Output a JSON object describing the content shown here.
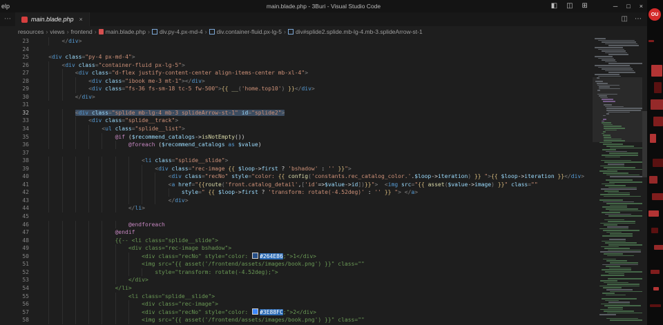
{
  "titlebar": {
    "menu_fragment": "elp",
    "title": "main.blade.php - 3Buri - Visual Studio Code"
  },
  "icons": {
    "toggle_sidebar": "◧",
    "toggle_panel": "◫",
    "customize_layout": "⊞",
    "minimize": "─",
    "maximize": "□",
    "close": "×",
    "overflow": "⋯",
    "split_editor": "◫",
    "more_actions": "⋯",
    "tab_close": "×",
    "breadcrumb_separator": "›"
  },
  "tabbar": {
    "tab": {
      "label": "main.blade.php"
    }
  },
  "breadcrumbs": [
    {
      "label": "resources",
      "icon": "none"
    },
    {
      "label": "views",
      "icon": "none"
    },
    {
      "label": "frontend",
      "icon": "none"
    },
    {
      "label": "main.blade.php",
      "icon": "file"
    },
    {
      "label": "div.py-4.px-md-4",
      "icon": "symbol"
    },
    {
      "label": "div.container-fluid.px-lg-5",
      "icon": "symbol"
    },
    {
      "label": "div#splide2.splide.mb-lg-4.mb-3.splideArrow-st-1",
      "icon": "symbol"
    }
  ],
  "colors": {
    "selection": "#3c4c60",
    "hex_highlight": "#2d6cb5",
    "file_icon": "#d63f3f",
    "comment": "#6a9955",
    "swatch_1": "#264E86",
    "swatch_2": "#3E88FC"
  },
  "background_app": {
    "badge_text": "OU"
  },
  "editor": {
    "lines": [
      {
        "n": 23,
        "ind": 8,
        "t": [
          [
            "p",
            "</"
          ],
          [
            "t",
            "div"
          ],
          [
            "p",
            ">"
          ]
        ]
      },
      {
        "n": 24,
        "ind": 0,
        "t": []
      },
      {
        "n": 25,
        "ind": 4,
        "t": [
          [
            "p",
            "<"
          ],
          [
            "t",
            "div"
          ],
          [
            "x",
            " "
          ],
          [
            "a",
            "class"
          ],
          [
            "p",
            "="
          ],
          [
            "s",
            "\"py-4 px-md-4\""
          ],
          [
            "p",
            ">"
          ]
        ]
      },
      {
        "n": 26,
        "ind": 8,
        "t": [
          [
            "p",
            "<"
          ],
          [
            "t",
            "div"
          ],
          [
            "x",
            " "
          ],
          [
            "a",
            "class"
          ],
          [
            "p",
            "="
          ],
          [
            "s",
            "\"container-fluid px-lg-5\""
          ],
          [
            "p",
            ">"
          ]
        ]
      },
      {
        "n": 27,
        "ind": 12,
        "t": [
          [
            "p",
            "<"
          ],
          [
            "t",
            "div"
          ],
          [
            "x",
            " "
          ],
          [
            "a",
            "class"
          ],
          [
            "p",
            "="
          ],
          [
            "s",
            "\"d-flex justify-content-center align-items-center mb-xl-4\""
          ],
          [
            "p",
            ">"
          ]
        ]
      },
      {
        "n": 28,
        "ind": 16,
        "t": [
          [
            "p",
            "<"
          ],
          [
            "t",
            "div"
          ],
          [
            "x",
            " "
          ],
          [
            "a",
            "class"
          ],
          [
            "p",
            "="
          ],
          [
            "s",
            "\"ibook me-3 mt-1\""
          ],
          [
            "p",
            ">"
          ],
          [
            "p",
            "</"
          ],
          [
            "t",
            "div"
          ],
          [
            "p",
            ">"
          ]
        ]
      },
      {
        "n": 29,
        "ind": 16,
        "t": [
          [
            "p",
            "<"
          ],
          [
            "t",
            "div"
          ],
          [
            "x",
            " "
          ],
          [
            "a",
            "class"
          ],
          [
            "p",
            "="
          ],
          [
            "s",
            "\"fs-36 fs-sm-18 tc-5 fw-500\""
          ],
          [
            "p",
            ">"
          ],
          [
            "br",
            "{{"
          ],
          [
            "x",
            " "
          ],
          [
            "f",
            "__"
          ],
          [
            "p",
            "("
          ],
          [
            "s",
            "'home.top10'"
          ],
          [
            "p",
            ")"
          ],
          [
            "x",
            " "
          ],
          [
            "br",
            "}}"
          ],
          [
            "p",
            "</"
          ],
          [
            "t",
            "div"
          ],
          [
            "p",
            ">"
          ]
        ]
      },
      {
        "n": 30,
        "ind": 12,
        "t": [
          [
            "p",
            "</"
          ],
          [
            "t",
            "div"
          ],
          [
            "p",
            ">"
          ]
        ]
      },
      {
        "n": 31,
        "ind": 0,
        "t": []
      },
      {
        "n": 32,
        "ind": 12,
        "sel": true,
        "t": [
          [
            "p",
            "<"
          ],
          [
            "t",
            "div"
          ],
          [
            "x",
            " "
          ],
          [
            "a",
            "class"
          ],
          [
            "p",
            "="
          ],
          [
            "s",
            "\"splide mb-lg-4 mb-3 splideArrow-st-1\""
          ],
          [
            "x",
            " "
          ],
          [
            "a",
            "id"
          ],
          [
            "p",
            "="
          ],
          [
            "s",
            "\"splide2\""
          ],
          [
            "p",
            ">"
          ]
        ]
      },
      {
        "n": 33,
        "ind": 16,
        "t": [
          [
            "p",
            "<"
          ],
          [
            "t",
            "div"
          ],
          [
            "x",
            " "
          ],
          [
            "a",
            "class"
          ],
          [
            "p",
            "="
          ],
          [
            "s",
            "\"splide__track\""
          ],
          [
            "p",
            ">"
          ]
        ]
      },
      {
        "n": 34,
        "ind": 20,
        "t": [
          [
            "p",
            "<"
          ],
          [
            "t",
            "ul"
          ],
          [
            "x",
            " "
          ],
          [
            "a",
            "class"
          ],
          [
            "p",
            "="
          ],
          [
            "s",
            "\"splide__list\""
          ],
          [
            "p",
            ">"
          ]
        ]
      },
      {
        "n": 35,
        "ind": 24,
        "t": [
          [
            "b",
            "@if"
          ],
          [
            "x",
            " ("
          ],
          [
            "v",
            "$recommend_catalogs"
          ],
          [
            "x",
            "->"
          ],
          [
            "f",
            "isNotEmpty"
          ],
          [
            "x",
            "())"
          ]
        ]
      },
      {
        "n": 36,
        "ind": 28,
        "t": [
          [
            "b",
            "@foreach"
          ],
          [
            "x",
            " ("
          ],
          [
            "v",
            "$recommend_catalogs"
          ],
          [
            "k",
            " as "
          ],
          [
            "v",
            "$value"
          ],
          [
            "x",
            ")"
          ]
        ]
      },
      {
        "n": 37,
        "ind": 0,
        "t": []
      },
      {
        "n": 38,
        "ind": 32,
        "t": [
          [
            "p",
            "<"
          ],
          [
            "t",
            "li"
          ],
          [
            "x",
            " "
          ],
          [
            "a",
            "class"
          ],
          [
            "p",
            "="
          ],
          [
            "s",
            "\"splide__slide\""
          ],
          [
            "p",
            ">"
          ]
        ]
      },
      {
        "n": 39,
        "ind": 36,
        "t": [
          [
            "p",
            "<"
          ],
          [
            "t",
            "div"
          ],
          [
            "x",
            " "
          ],
          [
            "a",
            "class"
          ],
          [
            "p",
            "="
          ],
          [
            "s",
            "\"rec-image "
          ],
          [
            "br",
            "{{"
          ],
          [
            "x",
            " "
          ],
          [
            "v",
            "$loop"
          ],
          [
            "x",
            "->"
          ],
          [
            "a",
            "first"
          ],
          [
            "x",
            " ? "
          ],
          [
            "s",
            "'bshadow'"
          ],
          [
            "x",
            " : "
          ],
          [
            "s",
            "''"
          ],
          [
            "x",
            " "
          ],
          [
            "br",
            "}}"
          ],
          [
            "s",
            "\""
          ],
          [
            "p",
            ">"
          ]
        ]
      },
      {
        "n": 40,
        "ind": 40,
        "t": [
          [
            "p",
            "<"
          ],
          [
            "t",
            "div"
          ],
          [
            "x",
            " "
          ],
          [
            "a",
            "class"
          ],
          [
            "p",
            "="
          ],
          [
            "s",
            "\"recNo\""
          ],
          [
            "x",
            " "
          ],
          [
            "a",
            "style"
          ],
          [
            "p",
            "="
          ],
          [
            "s",
            "\"color: "
          ],
          [
            "br",
            "{{"
          ],
          [
            "x",
            " "
          ],
          [
            "f",
            "config"
          ],
          [
            "p",
            "("
          ],
          [
            "s",
            "'constants.rec_catalog_color.'"
          ],
          [
            "x",
            "."
          ],
          [
            "v",
            "$loop"
          ],
          [
            "x",
            "->"
          ],
          [
            "a",
            "iteration"
          ],
          [
            "p",
            ")"
          ],
          [
            "x",
            " "
          ],
          [
            "br",
            "}}"
          ],
          [
            "s",
            " \""
          ],
          [
            "p",
            ">"
          ],
          [
            "br",
            "{{"
          ],
          [
            "x",
            " "
          ],
          [
            "v",
            "$loop"
          ],
          [
            "x",
            "->"
          ],
          [
            "a",
            "iteration"
          ],
          [
            "x",
            " "
          ],
          [
            "br",
            "}}"
          ],
          [
            "p",
            "</"
          ],
          [
            "t",
            "div"
          ],
          [
            "p",
            ">"
          ]
        ]
      },
      {
        "n": 41,
        "ind": 40,
        "t": [
          [
            "p",
            "<"
          ],
          [
            "t",
            "a"
          ],
          [
            "x",
            " "
          ],
          [
            "a",
            "href"
          ],
          [
            "p",
            "="
          ],
          [
            "s",
            "\""
          ],
          [
            "br",
            "{{"
          ],
          [
            "f",
            "route"
          ],
          [
            "p",
            "("
          ],
          [
            "s",
            "'front.catalog_detail'"
          ],
          [
            "x",
            ","
          ],
          [
            "p",
            "["
          ],
          [
            "s",
            "'id'"
          ],
          [
            "x",
            "=>"
          ],
          [
            "v",
            "$value"
          ],
          [
            "x",
            "->"
          ],
          [
            "a",
            "id"
          ],
          [
            "p",
            "])"
          ],
          [
            "br",
            "}}"
          ],
          [
            "s",
            "\""
          ],
          [
            "p",
            ">"
          ],
          [
            "x",
            "  "
          ],
          [
            "p",
            "<"
          ],
          [
            "t",
            "img"
          ],
          [
            "x",
            " "
          ],
          [
            "a",
            "src"
          ],
          [
            "p",
            "="
          ],
          [
            "s",
            "\""
          ],
          [
            "br",
            "{{"
          ],
          [
            "x",
            " "
          ],
          [
            "f",
            "asset"
          ],
          [
            "p",
            "("
          ],
          [
            "v",
            "$value"
          ],
          [
            "x",
            "->"
          ],
          [
            "a",
            "image"
          ],
          [
            "p",
            ")"
          ],
          [
            "x",
            " "
          ],
          [
            "br",
            "}}"
          ],
          [
            "s",
            "\""
          ],
          [
            "x",
            " "
          ],
          [
            "a",
            "class"
          ],
          [
            "p",
            "="
          ],
          [
            "s",
            "\"\""
          ]
        ]
      },
      {
        "n": 42,
        "ind": 44,
        "t": [
          [
            "a",
            "style"
          ],
          [
            "p",
            "="
          ],
          [
            "s",
            "\" "
          ],
          [
            "br",
            "{{"
          ],
          [
            "x",
            " "
          ],
          [
            "v",
            "$loop"
          ],
          [
            "x",
            "->"
          ],
          [
            "a",
            "first"
          ],
          [
            "x",
            " ? "
          ],
          [
            "s",
            "'transform: rotate(-4.52deg)'"
          ],
          [
            "x",
            " : "
          ],
          [
            "s",
            "''"
          ],
          [
            "x",
            " "
          ],
          [
            "br",
            "}}"
          ],
          [
            "s",
            " \""
          ],
          [
            "p",
            ">"
          ],
          [
            "x",
            " "
          ],
          [
            "p",
            "</"
          ],
          [
            "t",
            "a"
          ],
          [
            "p",
            ">"
          ]
        ]
      },
      {
        "n": 43,
        "ind": 40,
        "t": [
          [
            "p",
            "</"
          ],
          [
            "t",
            "div"
          ],
          [
            "p",
            ">"
          ]
        ]
      },
      {
        "n": 44,
        "ind": 28,
        "t": [
          [
            "p",
            "</"
          ],
          [
            "t",
            "li"
          ],
          [
            "p",
            ">"
          ]
        ]
      },
      {
        "n": 45,
        "ind": 0,
        "t": []
      },
      {
        "n": 46,
        "ind": 28,
        "t": [
          [
            "b",
            "@endforeach"
          ]
        ]
      },
      {
        "n": 47,
        "ind": 24,
        "t": [
          [
            "b",
            "@endif"
          ]
        ]
      },
      {
        "n": 48,
        "ind": 24,
        "t": [
          [
            "c",
            "{{-- <li class=\"splide__slide\">"
          ]
        ]
      },
      {
        "n": 49,
        "ind": 28,
        "t": [
          [
            "c",
            "<div class=\"rec-image bshadow\">"
          ]
        ]
      },
      {
        "n": 50,
        "ind": 32,
        "t": [
          [
            "c",
            "<div class=\"recNo\" style=\"color: "
          ],
          [
            "sw",
            "#264E86"
          ],
          [
            "sh",
            "#264E86"
          ],
          [
            "c",
            ";\">1</div>"
          ]
        ]
      },
      {
        "n": 51,
        "ind": 32,
        "t": [
          [
            "c",
            "<img src=\"{{ asset('/frontend/assets/images/book.png') }}\" class=\"\""
          ]
        ]
      },
      {
        "n": 52,
        "ind": 36,
        "t": [
          [
            "c",
            "style=\"transform: rotate(-4.52deg);\">"
          ]
        ]
      },
      {
        "n": 53,
        "ind": 28,
        "t": [
          [
            "c",
            "</div>"
          ]
        ]
      },
      {
        "n": 54,
        "ind": 24,
        "t": [
          [
            "c",
            "</li>"
          ]
        ]
      },
      {
        "n": 55,
        "ind": 28,
        "t": [
          [
            "c",
            "<li class=\"splide__slide\">"
          ]
        ]
      },
      {
        "n": 56,
        "ind": 32,
        "t": [
          [
            "c",
            "<div class=\"rec-image\">"
          ]
        ]
      },
      {
        "n": 57,
        "ind": 32,
        "t": [
          [
            "c",
            "<div class=\"recNo\" style=\"color: "
          ],
          [
            "sw",
            "#3E88FC"
          ],
          [
            "sh",
            "#3E88FC"
          ],
          [
            "c",
            ";\">2</div>"
          ]
        ]
      },
      {
        "n": 58,
        "ind": 32,
        "t": [
          [
            "c",
            "<img src=\"{{ asset('/frontend/assets/images/book.png') }}\" class=\"\""
          ]
        ]
      }
    ]
  }
}
